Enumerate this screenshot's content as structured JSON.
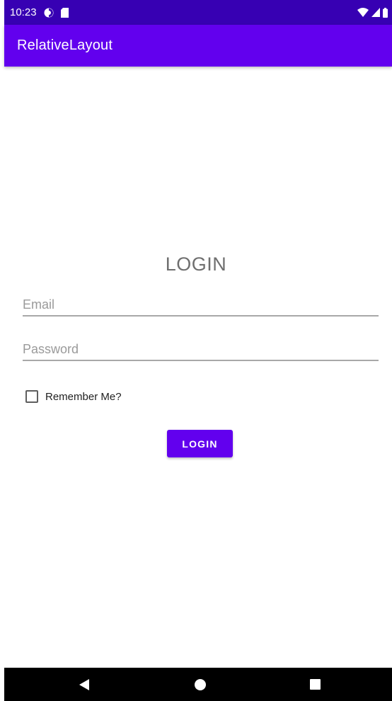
{
  "status_bar": {
    "time": "10:23",
    "left_icons": [
      "data-saver-icon",
      "sd-card-icon"
    ],
    "right_icons": [
      "wifi-icon",
      "cell-signal-icon",
      "battery-icon"
    ]
  },
  "app_bar": {
    "title": "RelativeLayout"
  },
  "form": {
    "heading": "LOGIN",
    "email_placeholder": "Email",
    "password_placeholder": "Password",
    "remember_label": "Remember Me?",
    "remember_checked": false,
    "login_button_label": "LOGIN"
  },
  "nav_bar": {
    "buttons": [
      "back-icon",
      "home-icon",
      "recents-icon"
    ]
  },
  "colors": {
    "status_bar": "#3700b3",
    "primary": "#6200ee",
    "nav_bar": "#000000"
  }
}
